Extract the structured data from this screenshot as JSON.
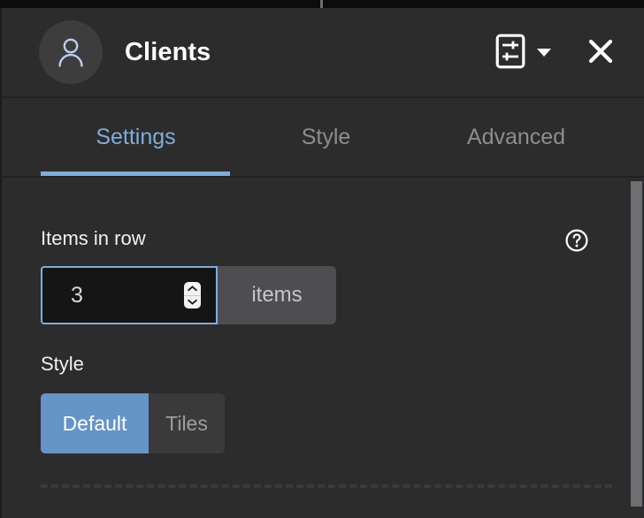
{
  "window": {
    "top_strip_tick": "editor-ruler-tick"
  },
  "header": {
    "avatar_icon": "person-icon",
    "title": "Clients",
    "actions": [
      {
        "icon": "sliders-panel-icon",
        "name": "layout-settings-button"
      },
      {
        "icon": "chevron-down-icon",
        "name": "layout-dropdown-button"
      },
      {
        "icon": "close-icon",
        "name": "close-panel-button"
      }
    ]
  },
  "tabs": [
    {
      "label": "Settings",
      "active": true
    },
    {
      "label": "Style",
      "active": false
    },
    {
      "label": "Advanced",
      "active": false
    }
  ],
  "content": {
    "items_in_row": {
      "label": "Items in row",
      "help_icon": "help-circle-icon",
      "value": "3",
      "unit": "items",
      "spinner_up_icon": "chevron-up-icon",
      "spinner_down_icon": "chevron-down-icon"
    },
    "style": {
      "label": "Style",
      "options": [
        {
          "label": "Default",
          "selected": true
        },
        {
          "label": "Tiles",
          "selected": false
        }
      ]
    }
  },
  "scrollbar": {
    "name": "vertical-scrollbar"
  },
  "colors": {
    "accent_blue": "#7eaedd",
    "selected_blue": "#6494c8",
    "panel_bg": "#2c2c2c",
    "input_bg": "#151515",
    "unit_bg": "#4e4e52",
    "avatar_bg": "#3d3d3d",
    "muted_text": "#8d8d8d"
  }
}
